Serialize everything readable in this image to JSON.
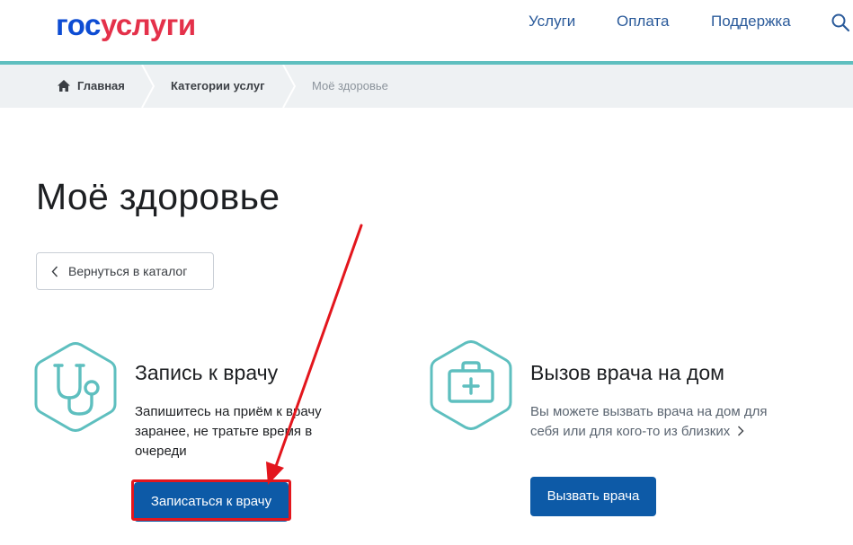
{
  "header": {
    "logo": {
      "part1": "гос",
      "part2": "услуги"
    },
    "nav": [
      "Услуги",
      "Оплата",
      "Поддержка"
    ],
    "icons": {
      "search": "search-icon"
    },
    "colors": {
      "brand_blue": "#0d4cd3",
      "brand_red": "#e4314a",
      "accent_teal": "#5ebfbf"
    }
  },
  "breadcrumb": {
    "items": [
      "Главная",
      "Категории услуг",
      "Моё здоровье"
    ]
  },
  "main": {
    "title": "Моё здоровье",
    "back_button": "Вернуться в каталог",
    "cards": [
      {
        "icon": "stethoscope-icon",
        "title": "Запись к врачу",
        "description": "Запишитесь на приём к врачу заранее, не тратьте время в очереди",
        "button": "Записаться к врачу"
      },
      {
        "icon": "medical-kit-icon",
        "title": "Вызов врача на дом",
        "description": "Вы можете вызвать врача на дом для себя или для кого-то из близких",
        "button": "Вызвать врача"
      }
    ],
    "colors": {
      "button_blue": "#0d5aa7",
      "annotation_red": "#e3161d"
    }
  }
}
